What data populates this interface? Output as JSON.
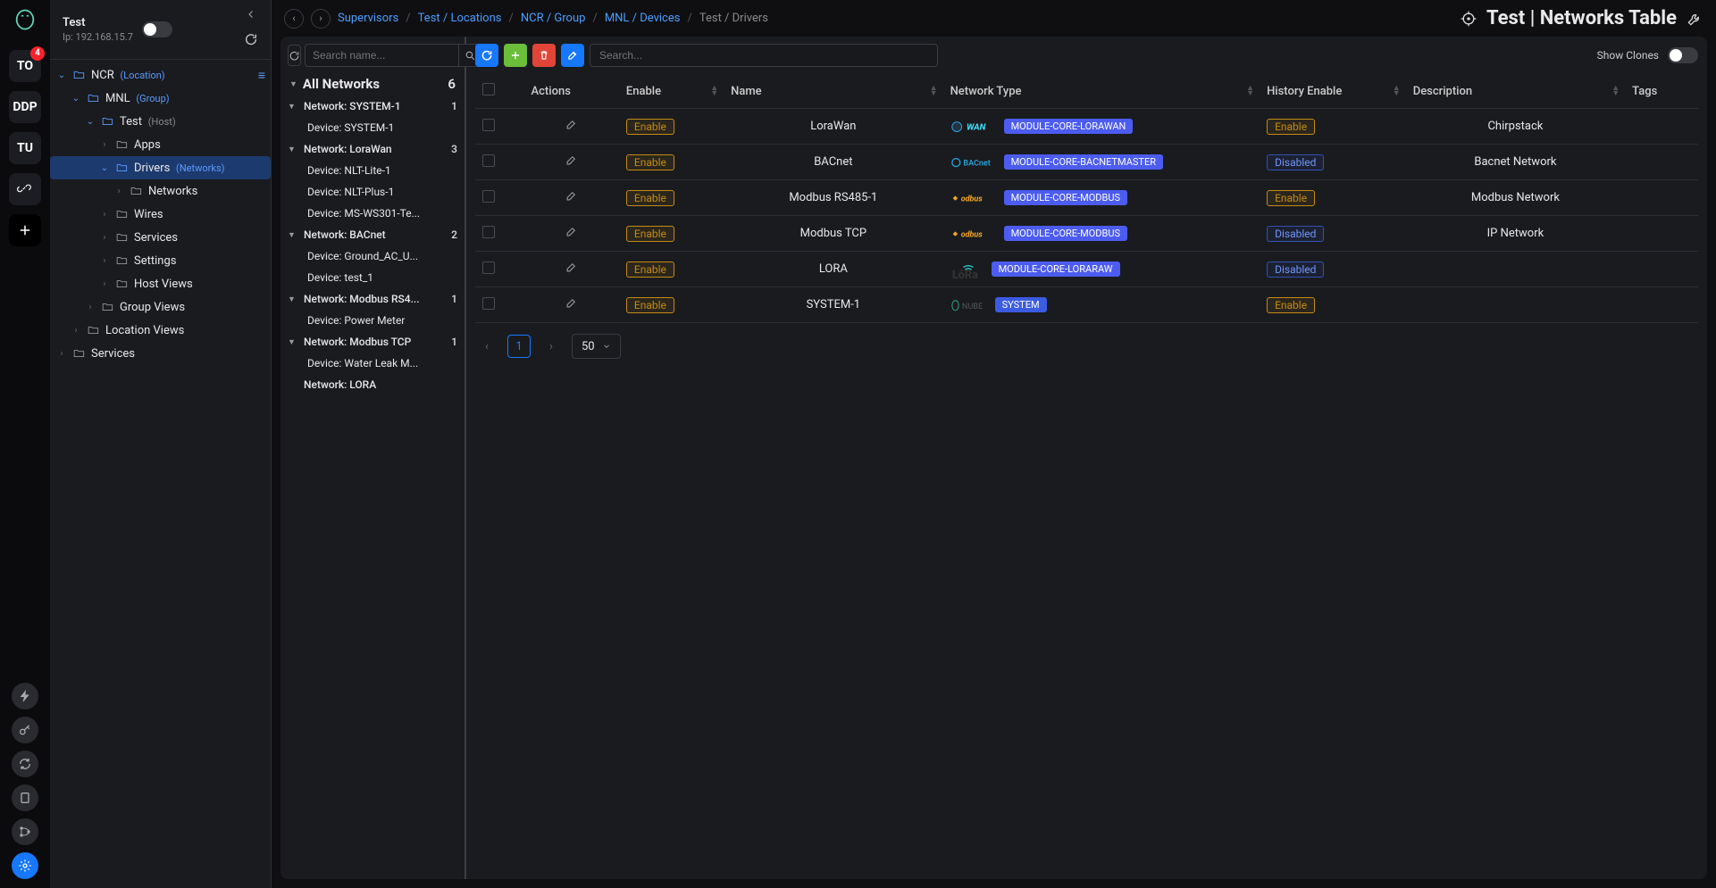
{
  "header": {
    "title": "Test",
    "ip_label": "Ip: 192.168.15.7"
  },
  "rail": {
    "badge": "4",
    "tiles": [
      "TO",
      "DDP",
      "TU"
    ]
  },
  "tree": [
    {
      "level": 0,
      "caret": "down",
      "open": true,
      "label": "NCR",
      "sub": "(Location)",
      "subClass": "blue",
      "menu": true
    },
    {
      "level": 1,
      "caret": "down",
      "open": true,
      "label": "MNL",
      "sub": "(Group)",
      "subClass": "blue"
    },
    {
      "level": 2,
      "caret": "down",
      "open": true,
      "label": "Test",
      "sub": "(Host)",
      "subClass": ""
    },
    {
      "level": 3,
      "caret": "right",
      "label": "Apps"
    },
    {
      "level": 3,
      "caret": "down",
      "open": true,
      "label": "Drivers",
      "sub": "(Networks)",
      "subClass": "blue",
      "selected": true
    },
    {
      "level": 4,
      "caret": "right",
      "label": "Networks"
    },
    {
      "level": 3,
      "caret": "right",
      "label": "Wires"
    },
    {
      "level": 3,
      "caret": "right",
      "label": "Services"
    },
    {
      "level": 3,
      "caret": "right",
      "label": "Settings"
    },
    {
      "level": 3,
      "caret": "right",
      "label": "Host Views"
    },
    {
      "level": 2,
      "caret": "right",
      "label": "Group Views"
    },
    {
      "level": 1,
      "caret": "right",
      "label": "Location Views"
    },
    {
      "level": 0,
      "caret": "right",
      "label": "Services"
    }
  ],
  "breadcrumbs": {
    "items": [
      {
        "label": "Supervisors",
        "link": true
      },
      {
        "label": "Test / Locations",
        "link": true
      },
      {
        "label": "NCR / Group",
        "link": true
      },
      {
        "label": "MNL / Devices",
        "link": true
      },
      {
        "label": "Test / Drivers",
        "link": false
      }
    ]
  },
  "page_title": "Test | Networks Table",
  "netlist": {
    "search_placeholder": "Search name...",
    "header": "All Networks",
    "count": "6",
    "items": [
      {
        "l": 1,
        "tri": true,
        "label": "Network: SYSTEM-1",
        "cnt": "1"
      },
      {
        "l": 2,
        "label": "Device: SYSTEM-1"
      },
      {
        "l": 1,
        "tri": true,
        "label": "Network: LoraWan",
        "cnt": "3"
      },
      {
        "l": 2,
        "label": "Device: NLT-Lite-1"
      },
      {
        "l": 2,
        "label": "Device: NLT-Plus-1"
      },
      {
        "l": 2,
        "label": "Device: MS-WS301-Te..."
      },
      {
        "l": 1,
        "tri": true,
        "label": "Network: BACnet",
        "cnt": "2"
      },
      {
        "l": 2,
        "label": "Device: Ground_AC_U..."
      },
      {
        "l": 2,
        "label": "Device: test_1"
      },
      {
        "l": 1,
        "tri": true,
        "label": "Network: Modbus RS4...",
        "cnt": "1"
      },
      {
        "l": 2,
        "label": "Device: Power Meter"
      },
      {
        "l": 1,
        "tri": true,
        "label": "Network: Modbus TCP",
        "cnt": "1"
      },
      {
        "l": 2,
        "label": "Device: Water Leak M..."
      },
      {
        "l": 1,
        "tri": false,
        "label": "Network: LORA"
      }
    ]
  },
  "toolbar": {
    "search_placeholder": "Search...",
    "show_clones": "Show Clones"
  },
  "columns": {
    "actions": "Actions",
    "enable": "Enable",
    "name": "Name",
    "type": "Network Type",
    "history": "History Enable",
    "desc": "Description",
    "tags": "Tags"
  },
  "rows": [
    {
      "name": "LoraWan",
      "icon": "wan",
      "tag": "MODULE-CORE-LORAWAN",
      "enable": "Enable",
      "history": "Enable",
      "desc": "Chirpstack"
    },
    {
      "name": "BACnet",
      "icon": "bacnet",
      "tag": "MODULE-CORE-BACNETMASTER",
      "enable": "Enable",
      "history": "Disabled",
      "desc": "Bacnet Network"
    },
    {
      "name": "Modbus RS485-1",
      "icon": "modbus",
      "tag": "MODULE-CORE-MODBUS",
      "enable": "Enable",
      "history": "Enable",
      "desc": "Modbus Network"
    },
    {
      "name": "Modbus TCP",
      "icon": "modbus",
      "tag": "MODULE-CORE-MODBUS",
      "enable": "Enable",
      "history": "Disabled",
      "desc": "IP Network"
    },
    {
      "name": "LORA",
      "icon": "lora",
      "tag": "MODULE-CORE-LORARAW",
      "enable": "Enable",
      "history": "Disabled",
      "desc": ""
    },
    {
      "name": "SYSTEM-1",
      "icon": "system",
      "tag": "SYSTEM",
      "tagClass": "system",
      "enable": "Enable",
      "history": "Enable",
      "desc": ""
    }
  ],
  "pager": {
    "page": "1",
    "size": "50"
  }
}
